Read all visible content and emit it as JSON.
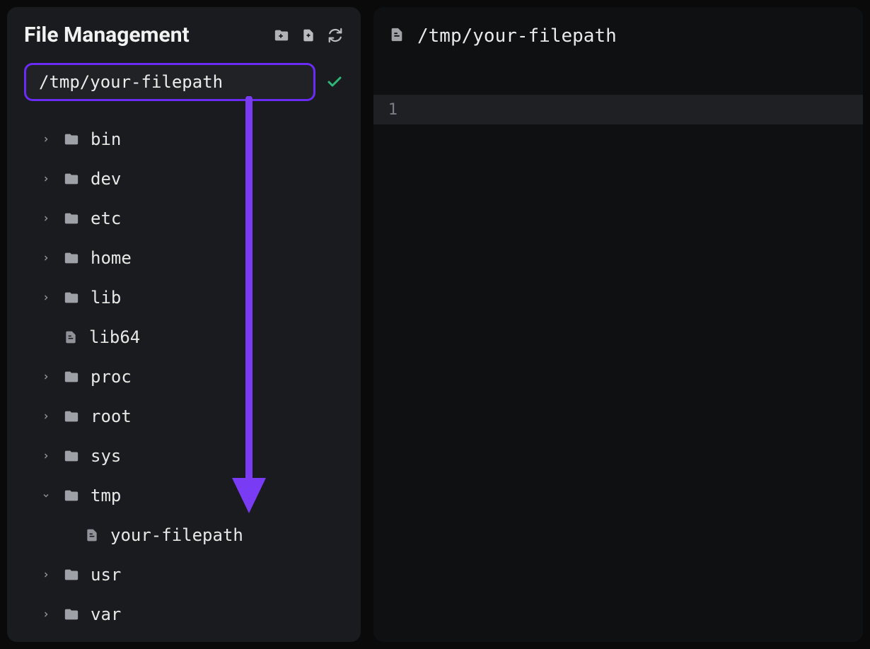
{
  "sidebar": {
    "title": "File Management",
    "path_value": "/tmp/your-filepath",
    "tree": {
      "bin": "bin",
      "dev": "dev",
      "etc": "etc",
      "home": "home",
      "lib": "lib",
      "lib64": "lib64",
      "proc": "proc",
      "root": "root",
      "sys": "sys",
      "tmp": "tmp",
      "your_filepath": "your-filepath",
      "usr": "usr",
      "var": "var"
    }
  },
  "main": {
    "open_path": "/tmp/your-filepath",
    "line_number": "1"
  },
  "colors": {
    "accent": "#6a2cf5",
    "success": "#2fb77a"
  }
}
